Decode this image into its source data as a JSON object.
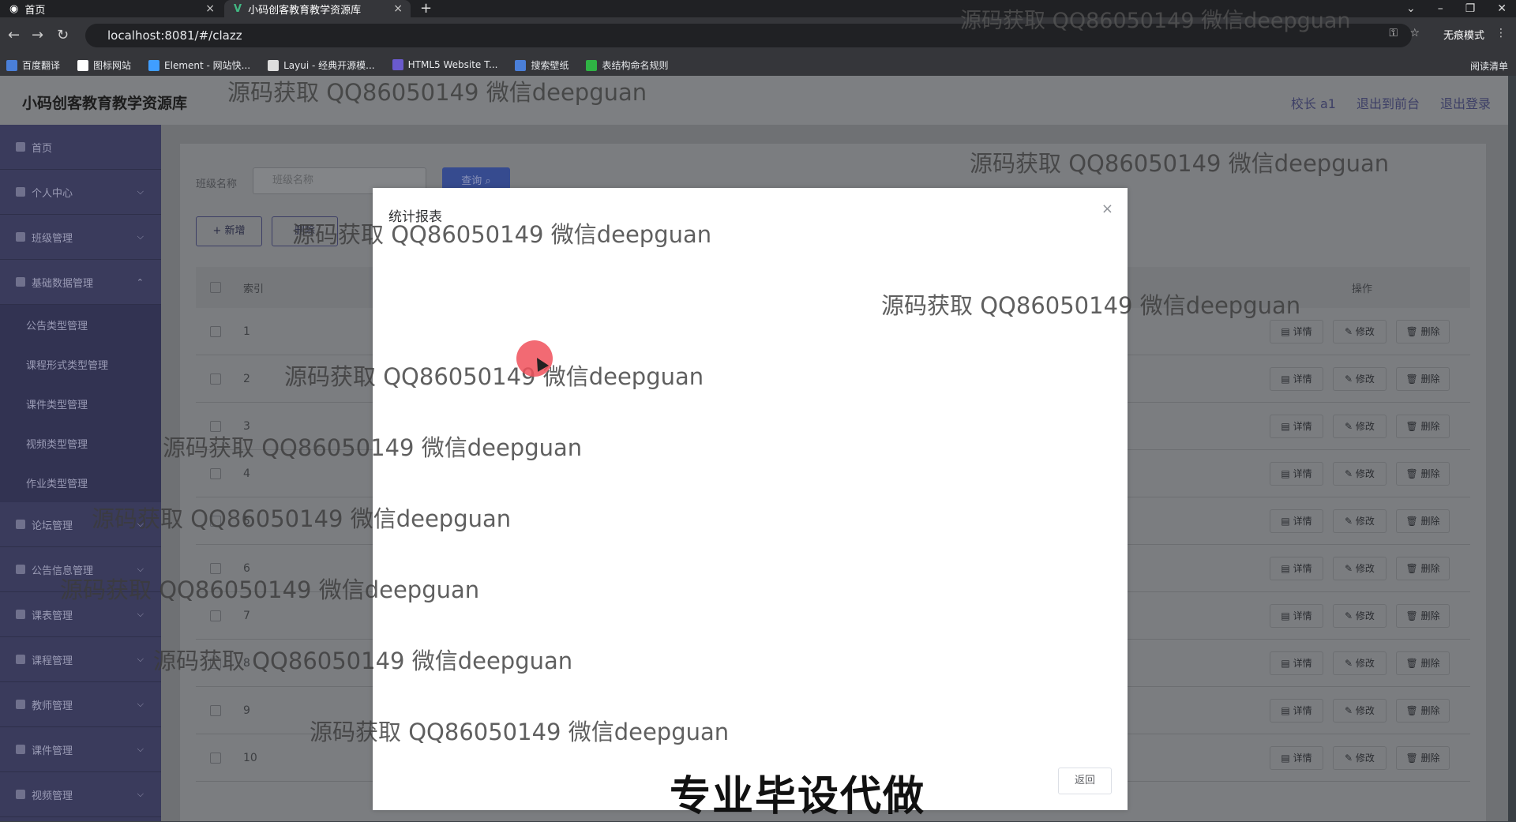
{
  "browser": {
    "tabs": [
      {
        "label": "首页",
        "close": "×"
      },
      {
        "label": "小码创客教育教学资源库",
        "close": "×"
      }
    ],
    "new_tab": "+",
    "url": "localhost:8081/#/clazz",
    "incognito": "无痕模式",
    "bookmarks": [
      "百度翻译",
      "图标网站",
      "Element - 网站快...",
      "Layui - 经典开源模...",
      "HTML5 Website T...",
      "搜索壁纸",
      "表结构命名规则"
    ],
    "reader": "阅读清单"
  },
  "app": {
    "brand": "小码创客教育教学资源库",
    "top_links": [
      "校长 a1",
      "退出到前台",
      "退出登录"
    ],
    "menu": [
      {
        "label": "首页",
        "chevron": ""
      },
      {
        "label": "个人中心",
        "chevron": "⌵"
      },
      {
        "label": "班级管理",
        "chevron": "⌵"
      },
      {
        "label": "基础数据管理",
        "chevron": "⌃"
      }
    ],
    "submenu": [
      "公告类型管理",
      "课程形式类型管理",
      "课件类型管理",
      "视频类型管理",
      "作业类型管理"
    ],
    "menu2": [
      {
        "label": "论坛管理",
        "chevron": "⌵"
      },
      {
        "label": "公告信息管理",
        "chevron": "⌵"
      },
      {
        "label": "课表管理",
        "chevron": "⌵"
      },
      {
        "label": "课程管理",
        "chevron": "⌵"
      },
      {
        "label": "教师管理",
        "chevron": "⌵"
      },
      {
        "label": "课件管理",
        "chevron": "⌵"
      },
      {
        "label": "视频管理",
        "chevron": "⌵"
      }
    ],
    "search_label": "班级名称",
    "search_placeholder": "班级名称",
    "query_btn": "查询",
    "add_btn": "+ 新增",
    "del_btn": "删除",
    "table_header": {
      "index": "索引",
      "ops": "操作"
    },
    "rows": [
      "1",
      "2",
      "3",
      "4",
      "5",
      "6",
      "7",
      "8",
      "9",
      "10"
    ],
    "row_ops": {
      "detail": "详情",
      "edit": "修改",
      "delete": "删除"
    }
  },
  "modal": {
    "title": "统计报表",
    "close": "×",
    "back": "返回"
  },
  "watermark": "源码获取 QQ86050149 微信deepguan",
  "banner": "专业毕设代做"
}
